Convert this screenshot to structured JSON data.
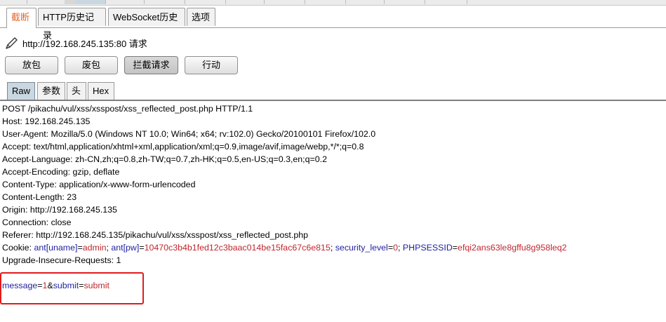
{
  "top_tabs": [
    "截断",
    "HTTP历史记录",
    "WebSocket历史",
    "选项"
  ],
  "request_label": "http://192.168.245.135:80 请求",
  "icon": "pencil-icon",
  "buttons": [
    "放包",
    "废包",
    "拦截请求",
    "行动"
  ],
  "view_tabs": [
    "Raw",
    "参数",
    "头",
    "Hex"
  ],
  "colors": {
    "active_tab_text": "#e8662a",
    "param_name": "#1e1ea0",
    "param_value": "#c0262e",
    "highlight_box": "#e01c1c"
  },
  "request": {
    "request_line": "POST /pikachu/vul/xss/xsspost/xss_reflected_post.php HTTP/1.1",
    "host": "Host: 192.168.245.135",
    "user_agent": "User-Agent: Mozilla/5.0 (Windows NT 10.0; Win64; x64; rv:102.0) Gecko/20100101 Firefox/102.0",
    "accept": "Accept: text/html,application/xhtml+xml,application/xml;q=0.9,image/avif,image/webp,*/*;q=0.8",
    "accept_language": "Accept-Language: zh-CN,zh;q=0.8,zh-TW;q=0.7,zh-HK;q=0.5,en-US;q=0.3,en;q=0.2",
    "accept_encoding": "Accept-Encoding: gzip, deflate",
    "content_type": "Content-Type: application/x-www-form-urlencoded",
    "content_length": "Content-Length: 23",
    "origin": "Origin: http://192.168.245.135",
    "connection": "Connection: close",
    "referer": "Referer: http://192.168.245.135/pikachu/vul/xss/xsspost/xss_reflected_post.php",
    "cookie": {
      "prefix": "Cookie: ",
      "ant_uname_key": "ant[uname]",
      "ant_uname_val": "admin",
      "ant_pw_key": "ant[pw]",
      "ant_pw_val": "10470c3b4b1fed12c3baac014be15fac67c6e815",
      "security_key": "security_level",
      "security_val": "0",
      "sess_key": "PHPSESSID",
      "sess_val": "efqi2ans63le8gffu8g958leq2"
    },
    "upgrade": "Upgrade-Insecure-Requests: 1",
    "body": {
      "message_key": "message",
      "message_val": "1",
      "submit_key": "submit",
      "submit_val": "submit"
    }
  }
}
